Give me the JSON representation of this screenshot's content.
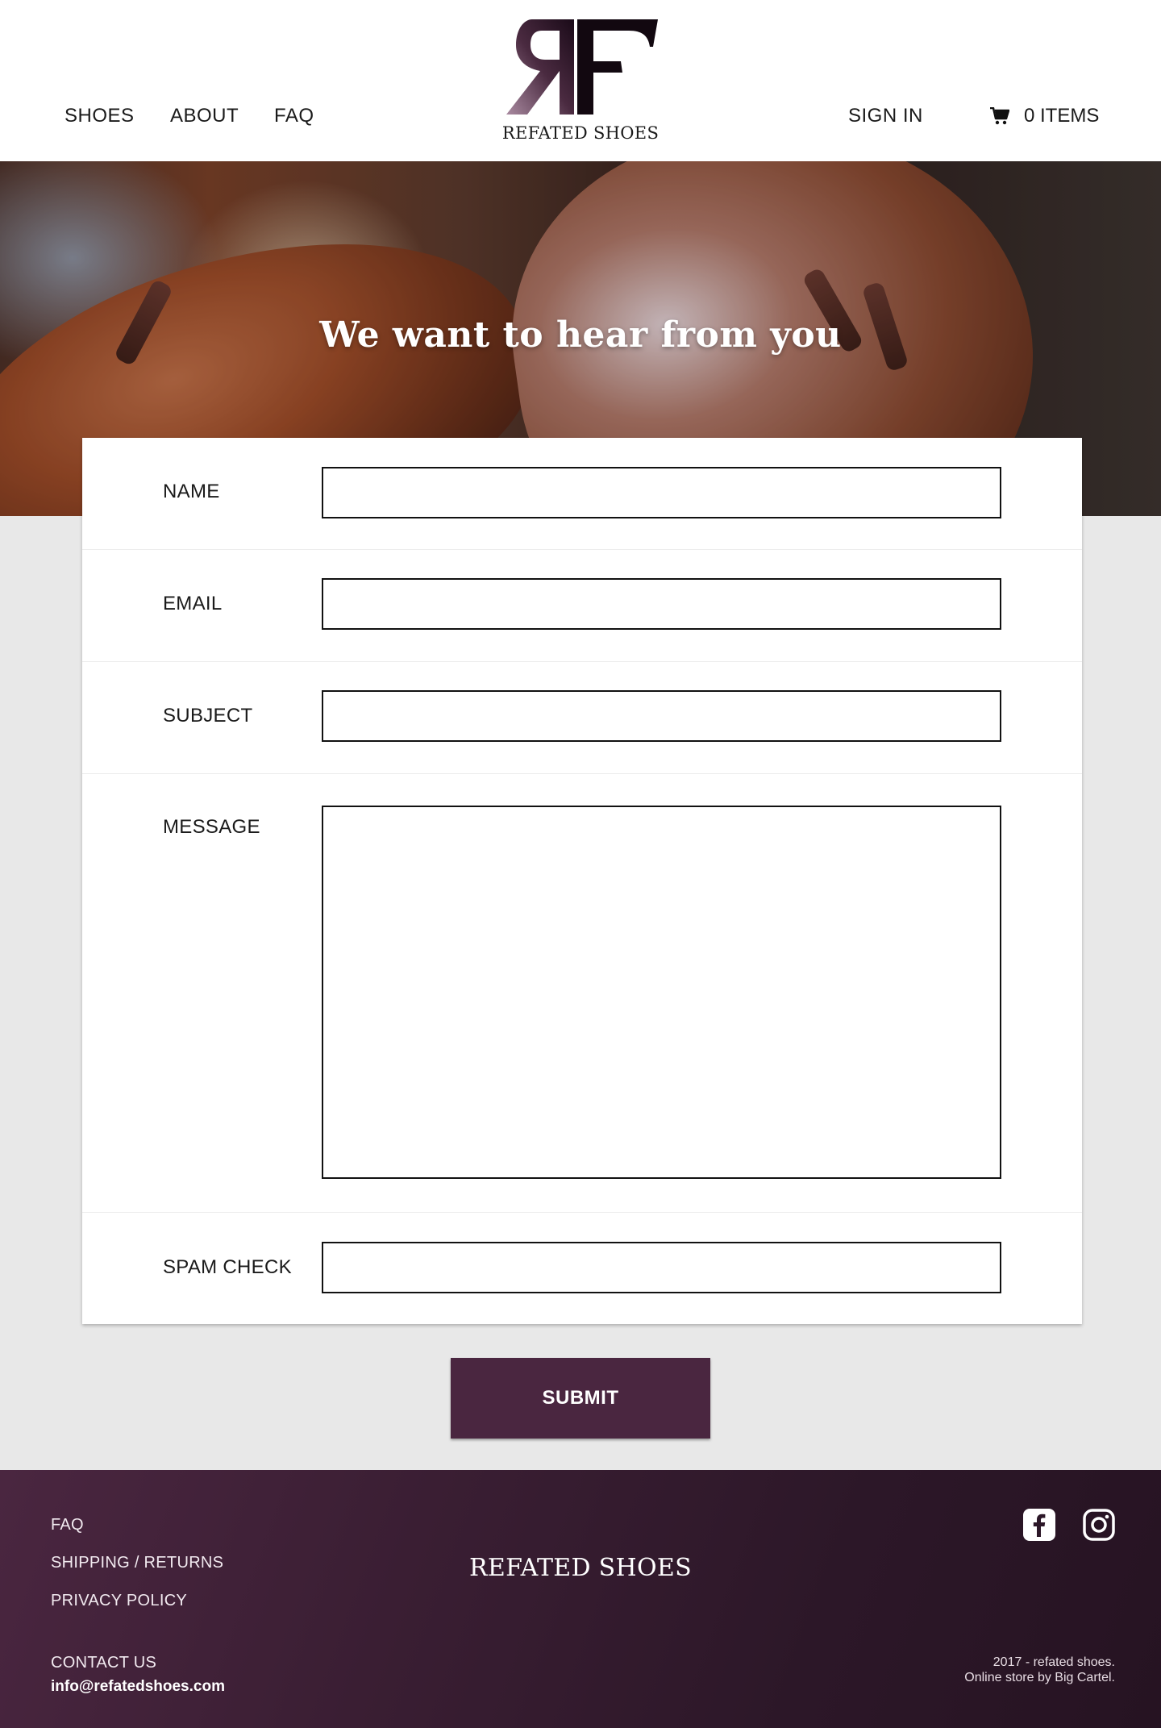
{
  "header": {
    "nav": [
      "SHOES",
      "ABOUT",
      "FAQ"
    ],
    "logo_text": "REFATED SHOES",
    "sign_in": "SIGN IN",
    "cart_label": "0 ITEMS",
    "cart_icon": "cart-icon"
  },
  "hero": {
    "title": "We want to hear from you"
  },
  "form": {
    "fields": [
      {
        "label": "NAME",
        "value": ""
      },
      {
        "label": "EMAIL",
        "value": ""
      },
      {
        "label": "SUBJECT",
        "value": ""
      },
      {
        "label": "MESSAGE",
        "value": ""
      },
      {
        "label": "SPAM CHECK",
        "value": ""
      }
    ],
    "submit_label": "SUBMIT"
  },
  "footer": {
    "links": [
      "FAQ",
      "SHIPPING / RETURNS",
      "PRIVACY POLICY",
      "CONTACT US"
    ],
    "email": "info@refatedshoes.com",
    "brand": "REFATED SHOES",
    "copyright": "2017 - refated shoes.",
    "powered_by": "Online store by Big Cartel.",
    "social_icons": [
      "facebook-icon",
      "instagram-icon"
    ]
  },
  "colors": {
    "accent": "#4a2640",
    "footer_bg": "#2c1728",
    "page_bg": "#e8e8e8"
  }
}
